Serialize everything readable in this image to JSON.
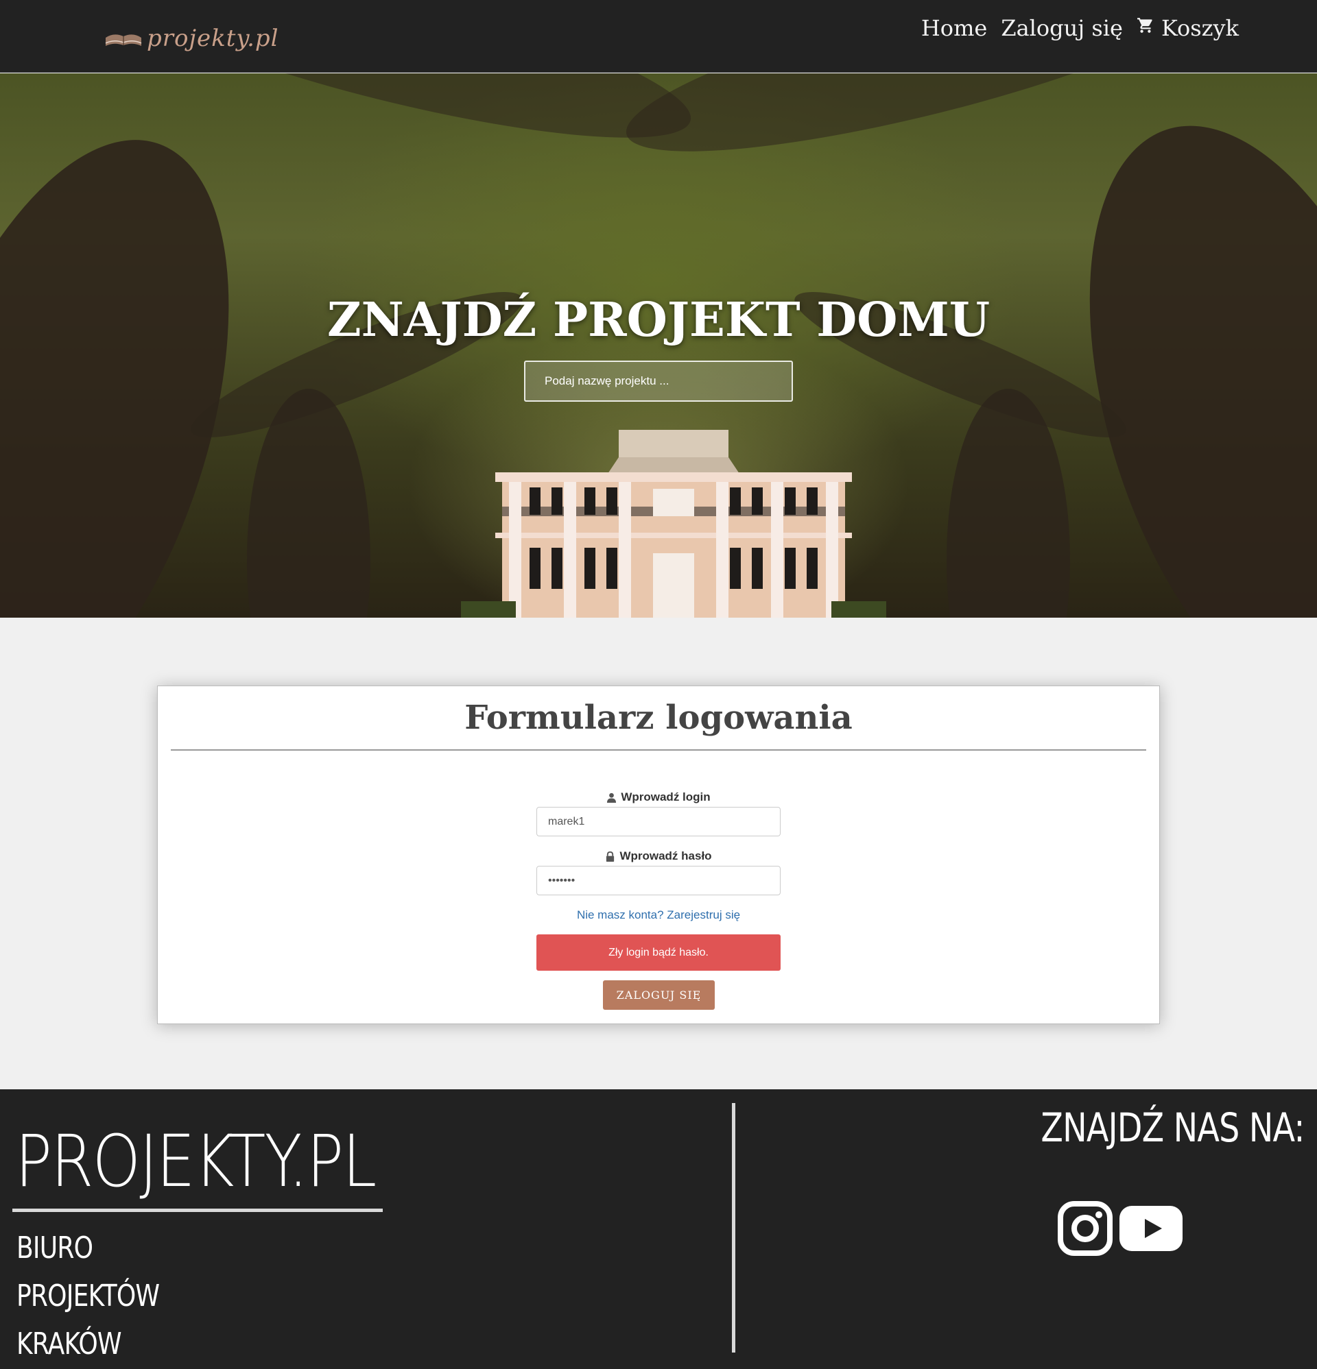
{
  "nav": {
    "logo_text": "projekty.pl",
    "links": [
      {
        "label": "Home"
      },
      {
        "label": "Zaloguj się"
      },
      {
        "label": "Koszyk",
        "icon": "cart-icon"
      }
    ]
  },
  "hero": {
    "title": "ZNAJDŹ PROJEKT DOMU",
    "search_placeholder": "Podaj nazwę projektu ..."
  },
  "login": {
    "title": "Formularz logowania",
    "login_label": "Wprowadź login",
    "login_icon": "user-icon",
    "login_value": "marek1",
    "password_label": "Wprowadź hasło",
    "password_icon": "lock-icon",
    "password_value": "•••••••",
    "register_link": "Nie masz konta? Zarejestruj się",
    "error_message": "Zły login bądź hasło.",
    "submit_label": "ZALOGUJ SIĘ"
  },
  "footer": {
    "brand": "PROJEKTY.PL",
    "lines": [
      "BIURO",
      "PROJEKTÓW",
      "KRAKÓW"
    ],
    "find_us": "ZNAJDŹ NAS NA:",
    "social": [
      "instagram-icon",
      "youtube-icon"
    ]
  },
  "colors": {
    "navbar_bg": "#222222",
    "accent": "#b87b5f",
    "error": "#e05454",
    "link": "#2f6fad",
    "page_bg": "#f0f0f0"
  }
}
